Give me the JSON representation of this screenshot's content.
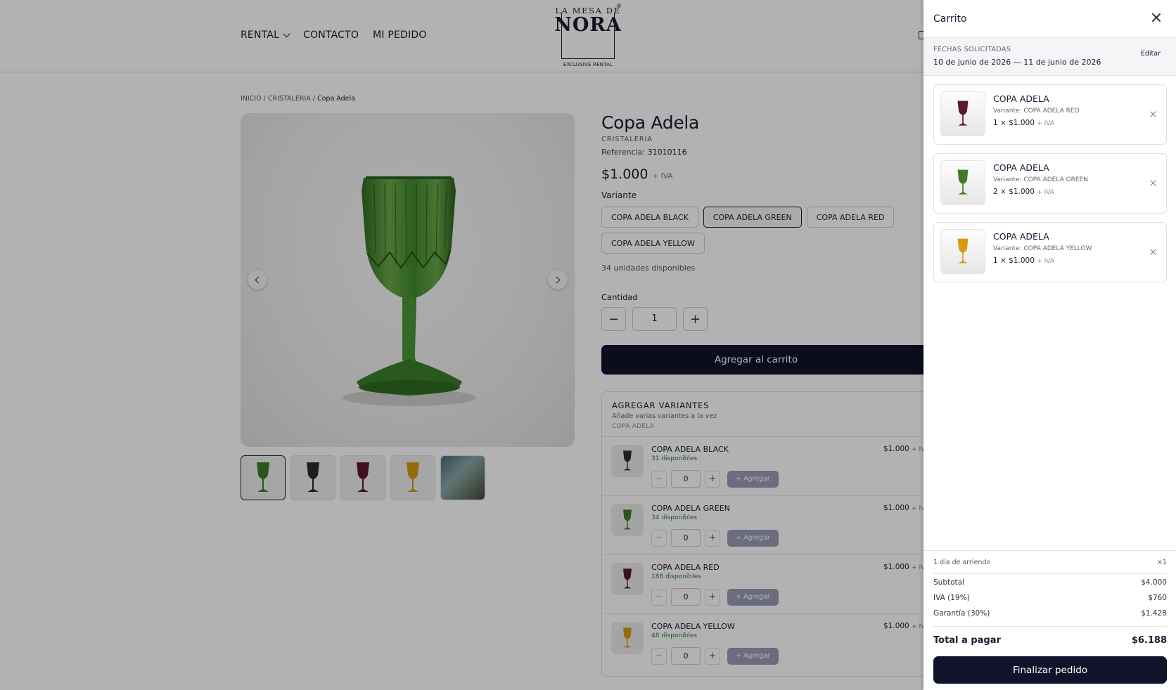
{
  "header": {
    "nav": [
      {
        "label": "RENTAL"
      },
      {
        "label": "CONTACTO"
      },
      {
        "label": "MI PEDIDO"
      }
    ],
    "logo": {
      "top": "LA MESA DE",
      "main": "NORA",
      "sub": "EXCLUSIVE RENTAL",
      "reg": "®"
    }
  },
  "breadcrumb": {
    "home": "INICIO",
    "category": "CRISTALERIA",
    "current": "Copa Adela",
    "sep": "/"
  },
  "product": {
    "title": "Copa Adela",
    "category": "CRISTALERIA",
    "ref_label": "Referencia:",
    "ref_value": "31010116",
    "price": "$1.000",
    "tax": "+ IVA",
    "variant_label": "Variante",
    "variants": [
      "COPA ADELA BLACK",
      "COPA ADELA GREEN",
      "COPA ADELA RED",
      "COPA ADELA YELLOW"
    ],
    "selected_variant": "COPA ADELA GREEN",
    "stock_count": "34",
    "stock_text": "unidades disponibles",
    "qty_label": "Cantidad",
    "qty_value": "1",
    "add_to_cart": "Agregar al carrito"
  },
  "multi": {
    "title": "AGREGAR VARIANTES",
    "subtitle": "Añade varias variantes a la vez",
    "product_name": "COPA ADELA",
    "rows": [
      {
        "name": "COPA ADELA BLACK",
        "avail": "31 disponibles",
        "price": "$1.000",
        "tax": "+ IVA",
        "qty": "0",
        "add": "+ Agregar",
        "color": "#2b2b2b"
      },
      {
        "name": "COPA ADELA GREEN",
        "avail": "34 disponibles",
        "price": "$1.000",
        "tax": "+ IVA",
        "qty": "0",
        "add": "+ Agregar",
        "color": "#3d7a2a"
      },
      {
        "name": "COPA ADELA RED",
        "avail": "188 disponibles",
        "price": "$1.000",
        "tax": "+ IVA",
        "qty": "0",
        "add": "+ Agregar",
        "color": "#5a1a2a"
      },
      {
        "name": "COPA ADELA YELLOW",
        "avail": "48 disponibles",
        "price": "$1.000",
        "tax": "+ IVA",
        "qty": "0",
        "add": "+ Agregar",
        "color": "#d99a12"
      }
    ]
  },
  "thumbs": [
    {
      "color": "#3d7a2a"
    },
    {
      "color": "#2b2b2b"
    },
    {
      "color": "#5a1a2a"
    },
    {
      "color": "#d99a12"
    },
    {
      "color": "scene"
    }
  ],
  "cart": {
    "title": "Carrito",
    "dates_label": "FECHAS SOLICITADAS",
    "dates_value": "10 de junio de 2026 — 11 de junio de 2026",
    "edit": "Editar",
    "items": [
      {
        "name": "COPA ADELA",
        "variant": "Variante: COPA ADELA RED",
        "qty_line": "1 × $1.000",
        "tax": "+ IVA",
        "color": "#5a1a2a"
      },
      {
        "name": "COPA ADELA",
        "variant": "Variante: COPA ADELA GREEN",
        "qty_line": "2 × $1.000",
        "tax": "+ IVA",
        "color": "#3d7a2a"
      },
      {
        "name": "COPA ADELA",
        "variant": "Variante: COPA ADELA YELLOW",
        "qty_line": "1 × $1.000",
        "tax": "+ IVA",
        "color": "#d99a12"
      }
    ],
    "rental_days": "1 día de arriendo",
    "rental_mult": "×1",
    "subtotal_label": "Subtotal",
    "subtotal": "$4.000",
    "iva_label": "IVA (19%)",
    "iva": "$760",
    "deposit_label": "Garantía (30%)",
    "deposit": "$1.428",
    "total_label": "Total a pagar",
    "total": "$6.188",
    "checkout": "Finalizar pedido"
  },
  "colors": {
    "primary": "#11132d",
    "stock_green": "#2a7a3a",
    "glass_green": "#3d7a2a"
  }
}
